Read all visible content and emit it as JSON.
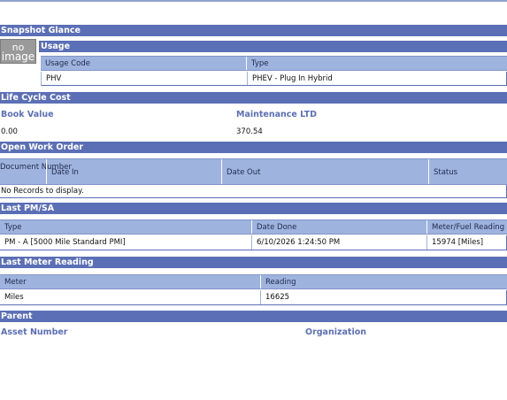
{
  "snapshot": {
    "title": "Snapshot Glance",
    "no_image_text_line1": "no",
    "no_image_text_line2": "image"
  },
  "usage": {
    "title": "Usage",
    "headers": [
      "Usage Code",
      "Type"
    ],
    "rows": [
      [
        "PHV",
        "PHEV - Plug In Hybrid"
      ]
    ]
  },
  "life_cycle_cost": {
    "title": "Life Cycle Cost",
    "book_value_label": "Book Value",
    "book_value": "0.00",
    "maintenance_label": "Maintenance LTD",
    "maintenance_value": "370.54"
  },
  "open_work_order": {
    "title": "Open Work Order",
    "headers": [
      "Document Number",
      "Date In",
      "Date Out",
      "Status"
    ],
    "empty_text": "No Records to display."
  },
  "last_pm": {
    "title": "Last PM/SA",
    "headers": [
      "Type",
      "Date Done",
      "Meter/Fuel Reading"
    ],
    "rows": [
      [
        "PM - A [5000 Mile Standard PMI]",
        "6/10/2026 1:24:50 PM",
        "15974 [Miles]"
      ]
    ]
  },
  "last_meter": {
    "title": "Last Meter Reading",
    "headers": [
      "Meter",
      "Reading"
    ],
    "rows": [
      [
        "Miles",
        "16625"
      ]
    ]
  },
  "parent": {
    "title": "Parent",
    "asset_number_label": "Asset Number",
    "organization_label": "Organization"
  },
  "colors": {
    "section_bar": "#5b6fb6",
    "table_header": "#9fb3df",
    "label_text": "#5b6fb6"
  }
}
